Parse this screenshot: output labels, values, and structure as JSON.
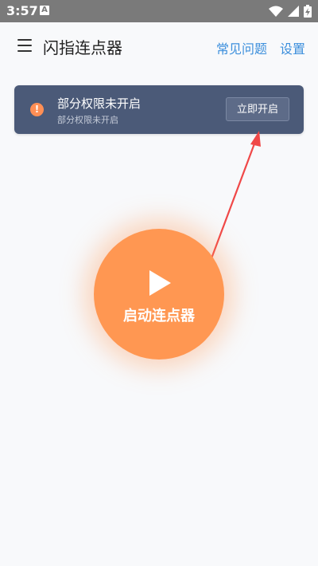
{
  "status_bar": {
    "time": "3:57",
    "notification_icon": "A",
    "icons": [
      "wifi-icon",
      "signal-icon",
      "battery-icon"
    ]
  },
  "app_bar": {
    "title": "闪指连点器",
    "faq_label": "常见问题",
    "settings_label": "设置"
  },
  "banner": {
    "title": "部分权限未开启",
    "subtitle": "部分权限未开启",
    "button_label": "立即开启",
    "warning_icon": "!"
  },
  "start": {
    "label": "启动连点器"
  },
  "colors": {
    "accent": "#ff9752",
    "link": "#3c8fdc",
    "banner_bg": "#4b5a78",
    "arrow": "#f04848"
  }
}
